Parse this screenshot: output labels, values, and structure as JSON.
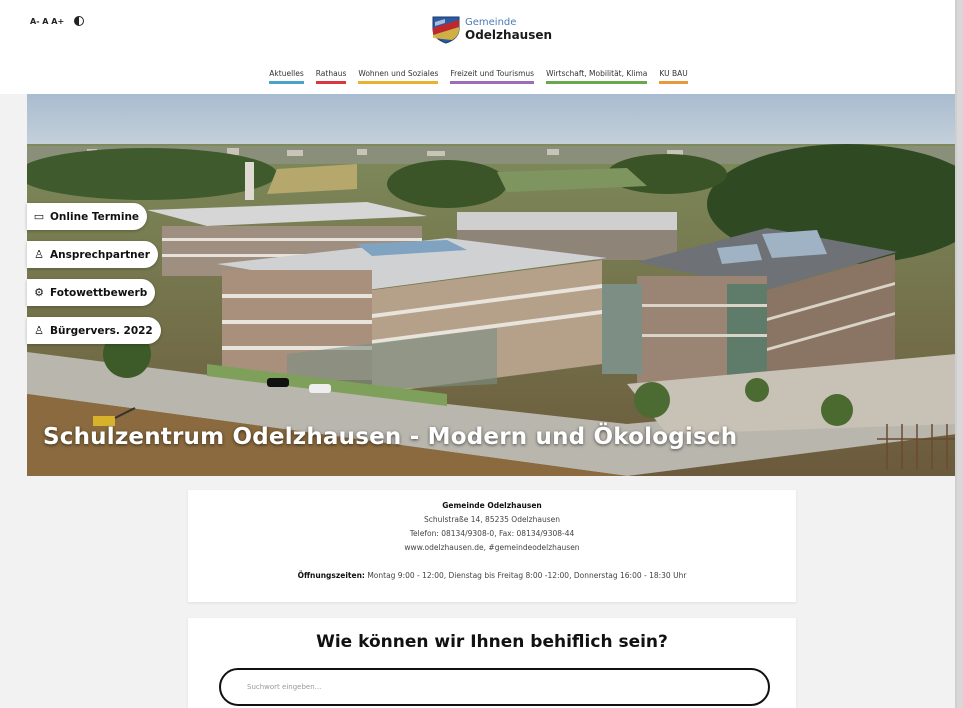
{
  "accessibility": {
    "font_controls": "A- A A+"
  },
  "logo": {
    "line1": "Gemeinde",
    "line2": "Odelzhausen"
  },
  "nav": [
    {
      "label": "Aktuelles",
      "color": "#4aa3c8"
    },
    {
      "label": "Rathaus",
      "color": "#d9363e"
    },
    {
      "label": "Wohnen und Soziales",
      "color": "#e9b233"
    },
    {
      "label": "Freizeit und Tourismus",
      "color": "#9b6fb7"
    },
    {
      "label": "Wirtschaft, Mobilität, Klima",
      "color": "#6aa84f"
    },
    {
      "label": "KU BAU",
      "color": "#e69a3c"
    }
  ],
  "hero": {
    "title": "Schulzentrum Odelzhausen - Modern und Ökologisch"
  },
  "quick_links": [
    {
      "label": "Online Termine",
      "icon": "calendar-icon"
    },
    {
      "label": "Ansprechpartner",
      "icon": "person-icon"
    },
    {
      "label": "Fotowettbewerb",
      "icon": "gear-icon"
    },
    {
      "label": "Bürgervers. 2022",
      "icon": "group-icon"
    }
  ],
  "contact": {
    "name": "Gemeinde Odelzhausen",
    "address": "Schulstraße 14, 85235 Odelzhausen",
    "phone": "Telefon: 08134/9308-0, Fax: 08134/9308-44",
    "web": "www.odelzhausen.de, #gemeindeodelzhausen",
    "hours_label": "Öffnungszeiten:",
    "hours": "Montag 9:00 - 12:00, Dienstag bis Freitag 8:00 -12:00, Donnerstag 16:00 - 18:30 Uhr"
  },
  "help": {
    "title": "Wie können wir Ihnen behiflich sein?",
    "search_placeholder": "Suchwort eingeben..."
  }
}
